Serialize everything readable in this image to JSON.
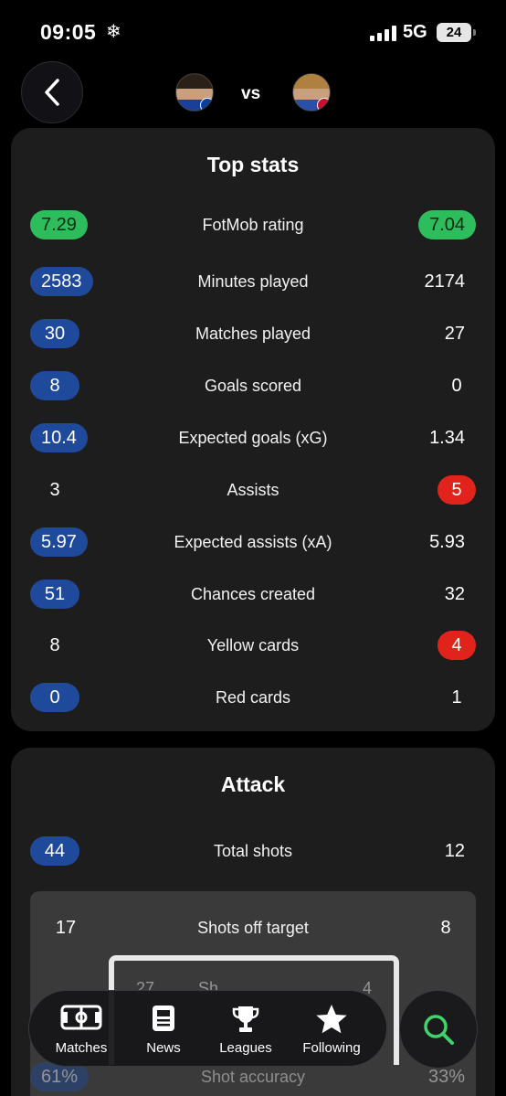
{
  "status_bar": {
    "time": "09:05",
    "time_icon": "❄",
    "network": "5G",
    "battery": "24"
  },
  "header": {
    "vs_label": "vs",
    "back_icon": "chevron-left-icon"
  },
  "colors": {
    "blue_pill": "#1f4a9c",
    "green_pill": "#2ebd5d",
    "red_pill": "#e0241b",
    "card_bg": "#1d1d1d",
    "search_accent": "#3fd36b"
  },
  "top_stats": {
    "title": "Top stats",
    "rows": [
      {
        "label": "FotMob rating",
        "left": "7.29",
        "right": "7.04",
        "left_style": "green",
        "right_style": "green"
      },
      {
        "label": "Minutes played",
        "left": "2583",
        "right": "2174",
        "left_style": "blue",
        "right_style": ""
      },
      {
        "label": "Matches played",
        "left": "30",
        "right": "27",
        "left_style": "blue",
        "right_style": ""
      },
      {
        "label": "Goals scored",
        "left": "8",
        "right": "0",
        "left_style": "blue",
        "right_style": ""
      },
      {
        "label": "Expected goals (xG)",
        "left": "10.4",
        "right": "1.34",
        "left_style": "blue",
        "right_style": ""
      },
      {
        "label": "Assists",
        "left": "3",
        "right": "5",
        "left_style": "",
        "right_style": "red"
      },
      {
        "label": "Expected assists (xA)",
        "left": "5.97",
        "right": "5.93",
        "left_style": "blue",
        "right_style": ""
      },
      {
        "label": "Chances created",
        "left": "51",
        "right": "32",
        "left_style": "blue",
        "right_style": ""
      },
      {
        "label": "Yellow cards",
        "left": "8",
        "right": "4",
        "left_style": "",
        "right_style": "red"
      },
      {
        "label": "Red cards",
        "left": "0",
        "right": "1",
        "left_style": "blue",
        "right_style": ""
      }
    ]
  },
  "attack": {
    "title": "Attack",
    "total_shots": {
      "label": "Total shots",
      "left": "44",
      "right": "12"
    },
    "shots_off_target": {
      "label": "Shots off target",
      "left": "17",
      "right": "8"
    },
    "shots_on_target_partial": {
      "left": "27",
      "label": "Sh",
      "right": "4"
    },
    "shot_accuracy": {
      "label": "Shot accuracy",
      "left": "61%",
      "right": "33%"
    }
  },
  "nav": {
    "items": [
      {
        "label": "Matches",
        "icon": "pitch-icon"
      },
      {
        "label": "News",
        "icon": "news-icon"
      },
      {
        "label": "Leagues",
        "icon": "trophy-icon"
      },
      {
        "label": "Following",
        "icon": "star-icon"
      }
    ],
    "search_icon": "search-icon"
  }
}
